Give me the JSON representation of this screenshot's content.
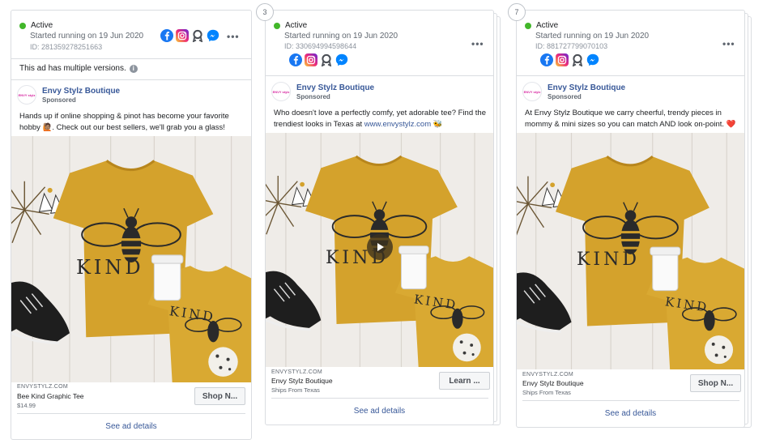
{
  "colors": {
    "active": "#42b72a",
    "link": "#385898",
    "tee": "#d4a22c"
  },
  "cards": [
    {
      "status": "Active",
      "started": "Started running on 19 Jun 2020",
      "id": "ID: 281359278251663",
      "platform_icons": [
        "facebook-icon",
        "instagram-icon",
        "audience-network-icon",
        "messenger-icon"
      ],
      "more": "•••",
      "multiple_versions": "This ad has multiple versions.",
      "page_name": "Envy Stylz Boutique",
      "avatar_text": "ENVY stylz",
      "sponsored": "Sponsored",
      "body": "Hands up if online shopping & pinot has become your favorite hobby 🙋🏽. Check out our best sellers, we'll grab you a glass!",
      "domain": "ENVYSTYLZ.COM",
      "title": "Bee Kind Graphic Tee",
      "desc": "$14.99",
      "cta": "Shop N...",
      "see_details": "See ad details",
      "creative_text": "KIND"
    },
    {
      "count": "3",
      "status": "Active",
      "started": "Started running on 19 Jun 2020",
      "id": "ID: 330694994598644",
      "platform_icons": [
        "facebook-icon",
        "instagram-icon",
        "audience-network-icon",
        "messenger-icon"
      ],
      "more": "•••",
      "page_name": "Envy Stylz Boutique",
      "avatar_text": "ENVY stylz",
      "sponsored": "Sponsored",
      "body_pre": "Who doesn't love a perfectly comfy, yet adorable tee? Find the trendiest looks in Texas at ",
      "body_link": "www.envystylz.com",
      "body_post": " 🐝",
      "domain": "ENVYSTYLZ.COM",
      "title": "Envy Stylz Boutique",
      "desc": "Ships From Texas",
      "cta": "Learn ...",
      "see_details": "See ad details",
      "creative_text": "KIND"
    },
    {
      "count": "7",
      "status": "Active",
      "started": "Started running on 19 Jun 2020",
      "id": "ID: 881727799070103",
      "platform_icons": [
        "facebook-icon",
        "instagram-icon",
        "audience-network-icon",
        "messenger-icon"
      ],
      "more": "•••",
      "page_name": "Envy Stylz Boutique",
      "avatar_text": "ENVY stylz",
      "sponsored": "Sponsored",
      "body": "At Envy Stylz Boutique we carry cheerful, trendy pieces in mommy & mini sizes so you can match AND look on-point. ❤️",
      "domain": "ENVYSTYLZ.COM",
      "title": "Envy Stylz Boutique",
      "desc": "Ships From Texas",
      "cta": "Shop N...",
      "see_details": "See ad details",
      "creative_text": "KIND"
    }
  ]
}
